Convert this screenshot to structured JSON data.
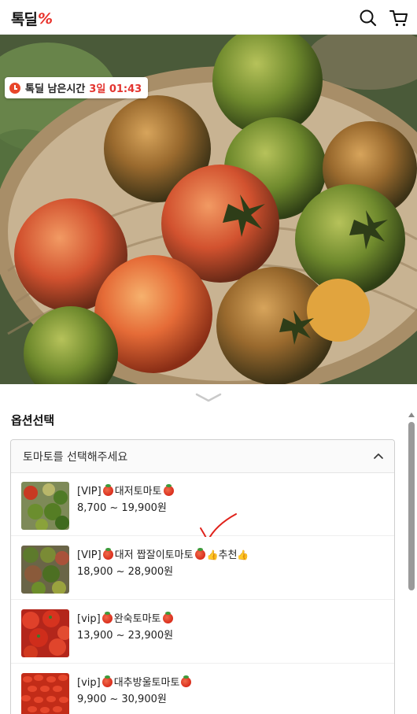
{
  "header": {
    "logo_text": "톡딜",
    "logo_mark": "%",
    "icons": [
      "search-icon",
      "cart-icon"
    ]
  },
  "hero": {
    "timer_label": "톡딜 남은시간",
    "timer_value": "3일 01:43",
    "icon": "clock-icon",
    "accent": "#e3342f"
  },
  "options": {
    "title": "옵션선택",
    "placeholder": "토마토를 선택해주세요",
    "items": [
      {
        "tag": "[VIP]",
        "name": "대저토마토",
        "price": "8,700 ~ 19,900원",
        "suffix": "",
        "thumbnail": "cherry-tomato-basket",
        "annotation": "red-check-mark"
      },
      {
        "tag": "[VIP]",
        "name": "대저 짭잘이토마토",
        "price": "18,900 ~ 28,900원",
        "suffix": "추천",
        "thumbnail": "green-tomato-crate",
        "annotation": ""
      },
      {
        "tag": "[vip]",
        "name": "완숙토마토",
        "price": "13,900 ~ 23,900원",
        "suffix": "",
        "thumbnail": "ripe-tomatoes",
        "annotation": ""
      },
      {
        "tag": "[vip]",
        "name": "대추방울토마토",
        "price": "9,900 ~ 30,900원",
        "suffix": "",
        "thumbnail": "cherry-tomatoes-pile",
        "annotation": ""
      }
    ]
  }
}
